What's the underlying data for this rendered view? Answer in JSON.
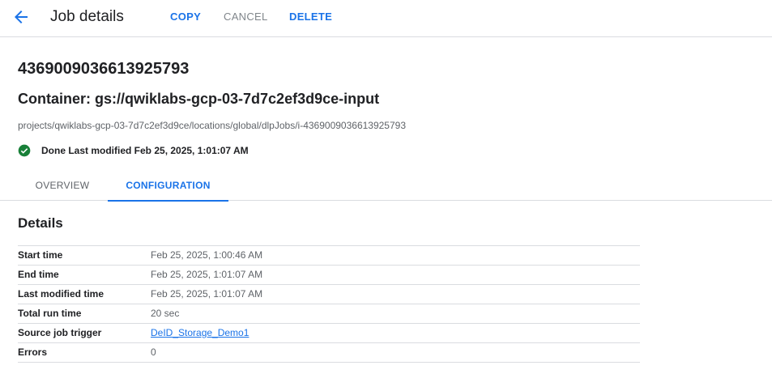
{
  "header": {
    "title": "Job details",
    "actions": {
      "copy": "COPY",
      "cancel": "CANCEL",
      "delete": "DELETE"
    }
  },
  "job": {
    "id": "4369009036613925793",
    "container": "Container: gs://qwiklabs-gcp-03-7d7c2ef3d9ce-input",
    "resource_path": "projects/qwiklabs-gcp-03-7d7c2ef3d9ce/locations/global/dlpJobs/i-4369009036613925793",
    "status_text": "Done Last modified Feb 25, 2025, 1:01:07 AM",
    "status_color": "#188038"
  },
  "tabs": [
    {
      "label": "OVERVIEW",
      "active": false
    },
    {
      "label": "CONFIGURATION",
      "active": true
    }
  ],
  "details": {
    "heading": "Details",
    "rows": [
      {
        "key": "Start time",
        "value": "Feb 25, 2025, 1:00:46 AM"
      },
      {
        "key": "End time",
        "value": "Feb 25, 2025, 1:01:07 AM"
      },
      {
        "key": "Last modified time",
        "value": "Feb 25, 2025, 1:01:07 AM"
      },
      {
        "key": "Total run time",
        "value": "20 sec"
      },
      {
        "key": "Source job trigger",
        "value": "DeID_Storage_Demo1"
      },
      {
        "key": "Errors",
        "value": "0"
      }
    ]
  },
  "colors": {
    "accent": "#1a73e8",
    "muted": "#5f6368",
    "divider": "#dadce0"
  },
  "icons": {
    "back": "arrow-back-icon",
    "status": "check-circle-icon"
  }
}
